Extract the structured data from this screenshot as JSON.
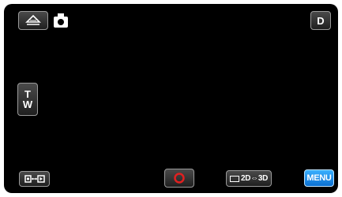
{
  "top_bar": {
    "left_button_icon": "eject-icon",
    "mode_icon": "camera-icon",
    "right_button_label": "D"
  },
  "zoom": {
    "tele_label": "T",
    "wide_label": "W"
  },
  "bottom_bar": {
    "left_button_icon": "playback-switch-icon",
    "record_button_icon": "record-ring-icon",
    "toggle_3d_label": "2D⇔3D",
    "menu_label": "MENU",
    "menu_color": "#1e90ff"
  }
}
